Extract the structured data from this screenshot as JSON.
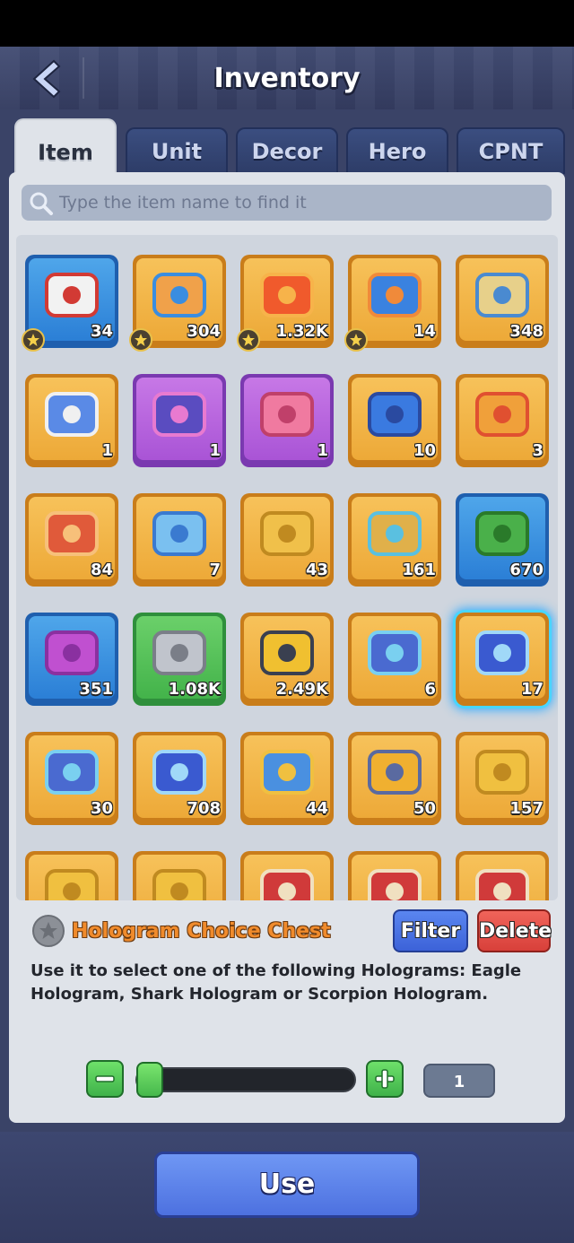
{
  "header": {
    "title": "Inventory"
  },
  "tabs": [
    {
      "label": "Item"
    },
    {
      "label": "Unit"
    },
    {
      "label": "Decor"
    },
    {
      "label": "Hero"
    },
    {
      "label": "CPNT"
    }
  ],
  "search": {
    "placeholder": "Type the item name to find it"
  },
  "items": [
    {
      "count": "34",
      "color": "blue",
      "icon": "sos-letter-icon",
      "starred": true
    },
    {
      "count": "304",
      "color": "orange",
      "icon": "paint-puzzle-icon",
      "starred": true
    },
    {
      "count": "1.32K",
      "color": "orange",
      "icon": "red-puzzle-icon",
      "starred": true
    },
    {
      "count": "14",
      "color": "orange",
      "icon": "blue-card-icon",
      "starred": true
    },
    {
      "count": "348",
      "color": "orange",
      "icon": "map-icon",
      "starred": false
    },
    {
      "count": "1",
      "color": "orange",
      "icon": "compass-icon",
      "starred": false
    },
    {
      "count": "1",
      "color": "purple",
      "icon": "purple-card-icon",
      "starred": false
    },
    {
      "count": "1",
      "color": "purple",
      "icon": "gift-box-icon",
      "starred": false
    },
    {
      "count": "10",
      "color": "orange",
      "icon": "blue-chest-icon",
      "starred": false
    },
    {
      "count": "3",
      "color": "orange",
      "icon": "mystery-cube-icon",
      "starred": false
    },
    {
      "count": "84",
      "color": "orange",
      "icon": "red-coin-icon",
      "starred": false
    },
    {
      "count": "7",
      "color": "orange",
      "icon": "ticket-icon",
      "starred": false
    },
    {
      "count": "43",
      "color": "orange",
      "icon": "gold-coin-icon",
      "starred": false
    },
    {
      "count": "161",
      "color": "orange",
      "icon": "gold-chest-icon",
      "starred": false
    },
    {
      "count": "670",
      "color": "blue",
      "icon": "green-cube-icon",
      "starred": false
    },
    {
      "count": "351",
      "color": "blue",
      "icon": "purple-chest-icon",
      "starred": false
    },
    {
      "count": "1.08K",
      "color": "green",
      "icon": "steel-chest-icon",
      "starred": false
    },
    {
      "count": "2.49K",
      "color": "orange",
      "icon": "yellow-crate-icon",
      "starred": false
    },
    {
      "count": "6",
      "color": "orange",
      "icon": "crystal-chest-icon",
      "starred": false
    },
    {
      "count": "17",
      "color": "orange",
      "icon": "hologram-chest-icon",
      "starred": false,
      "selected": true
    },
    {
      "count": "30",
      "color": "orange",
      "icon": "crystal-chest-icon",
      "starred": false
    },
    {
      "count": "708",
      "color": "orange",
      "icon": "hologram-chest-icon",
      "starred": false
    },
    {
      "count": "44",
      "color": "orange",
      "icon": "blueprint-icon",
      "starred": false
    },
    {
      "count": "50",
      "color": "orange",
      "icon": "fire-pot-icon",
      "starred": false
    },
    {
      "count": "157",
      "color": "orange",
      "icon": "gold-puzzle-icon",
      "starred": false
    },
    {
      "count": "",
      "color": "orange",
      "icon": "gold-puzzle-icon",
      "starred": false
    },
    {
      "count": "",
      "color": "orange",
      "icon": "gold-puzzle-icon",
      "starred": false
    },
    {
      "count": "",
      "color": "orange",
      "icon": "red-charm-icon",
      "starred": false
    },
    {
      "count": "",
      "color": "orange",
      "icon": "red-charm-icon",
      "starred": false
    },
    {
      "count": "",
      "color": "orange",
      "icon": "red-charm-icon",
      "starred": false
    }
  ],
  "detail": {
    "name": "Hologram Choice Chest",
    "filter_label": "Filter",
    "delete_label": "Delete",
    "description": "Use it to select one of the following Holograms: Eagle Hologram, Shark Hologram or Scorpion Hologram.",
    "quantity": "1"
  },
  "use_label": "Use"
}
